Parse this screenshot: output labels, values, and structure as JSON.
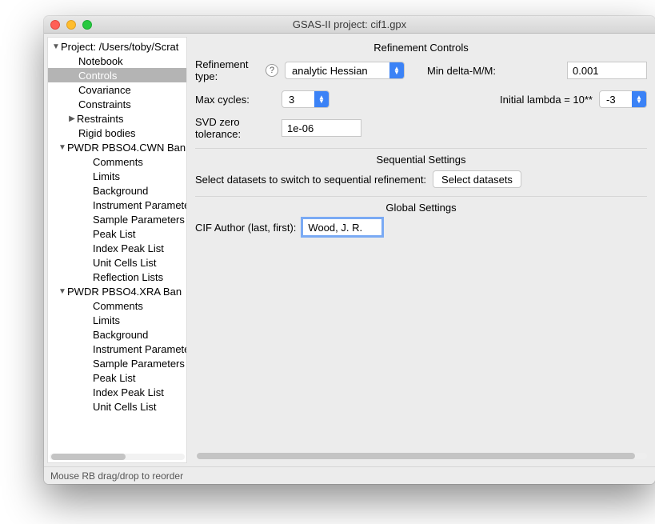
{
  "window": {
    "title": "GSAS-II project: cif1.gpx"
  },
  "tree": {
    "root": "Project: /Users/toby/Scrat",
    "items": [
      "Notebook",
      "Controls",
      "Covariance",
      "Constraints",
      "Restraints",
      "Rigid bodies"
    ],
    "ds1": {
      "label": "PWDR PBSO4.CWN Ban",
      "children": [
        "Comments",
        "Limits",
        "Background",
        "Instrument Paramete",
        "Sample Parameters",
        "Peak List",
        "Index Peak List",
        "Unit Cells List",
        "Reflection Lists"
      ]
    },
    "ds2": {
      "label": "PWDR PBSO4.XRA Ban",
      "children": [
        "Comments",
        "Limits",
        "Background",
        "Instrument Paramete",
        "Sample Parameters",
        "Peak List",
        "Index Peak List",
        "Unit Cells List"
      ]
    }
  },
  "main": {
    "refinement_controls_title": "Refinement Controls",
    "refinement_type_label": "Refinement type:",
    "refinement_type_value": "analytic Hessian",
    "min_delta_label": "Min delta-M/M:",
    "min_delta_value": "0.001",
    "max_cycles_label": "Max cycles:",
    "max_cycles_value": "3",
    "initial_lambda_label": "Initial lambda = 10**",
    "initial_lambda_value": "-3",
    "svd_label": "SVD zero tolerance:",
    "svd_value": "1e-06",
    "sequential_title": "Sequential Settings",
    "sequential_label": "Select datasets to switch to sequential refinement:",
    "select_datasets_btn": "Select datasets",
    "global_title": "Global Settings",
    "cif_author_label": "CIF Author (last, first):",
    "cif_author_value": "Wood, J. R."
  },
  "status": "Mouse RB drag/drop to reorder"
}
